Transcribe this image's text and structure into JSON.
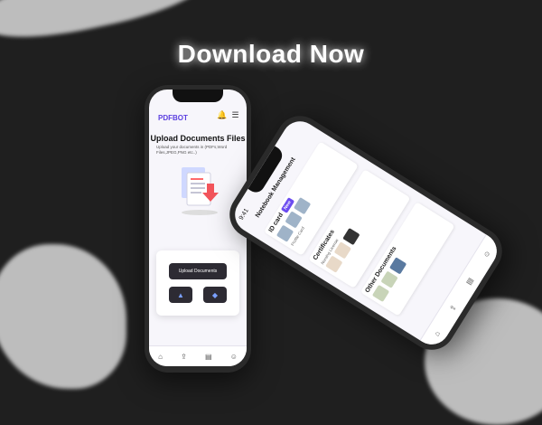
{
  "headline": "Download Now",
  "phone_left": {
    "brand": "PDFBOT",
    "icons": [
      "bell-icon",
      "menu-icon"
    ],
    "upload_title": "Upload Documents Files",
    "upload_desc": "Upload your documents in (PDFs,Word Files,JPEG,PNG etc..)",
    "upload_button": "Upload Documents",
    "nav": [
      "home-icon",
      "upload-icon",
      "documents-icon",
      "profile-icon"
    ]
  },
  "phone_right": {
    "time": "9:41",
    "title": "Notebook Management",
    "sections": [
      {
        "title": "ID card",
        "badge": "New",
        "sub": "Profile Card"
      },
      {
        "title": "Certificates",
        "badge": "",
        "sub": "Nursing License"
      },
      {
        "title": "Other Documents",
        "badge": "",
        "sub": ""
      }
    ]
  },
  "colors": {
    "background": "#1f1f1f",
    "accent": "#5b3fe0",
    "dark_button": "#2d2b33"
  }
}
